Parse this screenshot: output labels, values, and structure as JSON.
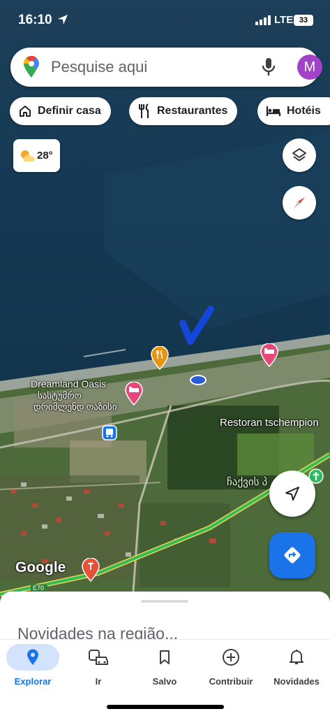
{
  "status_bar": {
    "time": "16:10",
    "network": "LTE",
    "battery": "33"
  },
  "search": {
    "placeholder": "Pesquise aqui",
    "avatar_letter": "M"
  },
  "chips": [
    {
      "label": "Definir casa",
      "icon": "home-icon"
    },
    {
      "label": "Restaurantes",
      "icon": "restaurant-icon"
    },
    {
      "label": "Hotéis",
      "icon": "hotel-icon"
    }
  ],
  "weather": {
    "temperature": "28°",
    "icon": "partly-cloudy-icon"
  },
  "map": {
    "labels": {
      "dreamland_latin": "Dreamland Oasis",
      "dreamland_georgian_1": "სასტუმრო",
      "dreamland_georgian_2": "დრიმლენდ ოაზისი",
      "restaurant": "Restoran tschempion",
      "georgian_place": "ჩაქვის პ",
      "google": "Google",
      "road": "E70"
    }
  },
  "bottom_sheet": {
    "title": "Novidades na região..."
  },
  "tabs": [
    {
      "label": "Explorar",
      "icon": "explore-pin-icon",
      "active": true
    },
    {
      "label": "Ir",
      "icon": "commute-icon",
      "active": false
    },
    {
      "label": "Salvo",
      "icon": "bookmark-icon",
      "active": false
    },
    {
      "label": "Contribuir",
      "icon": "add-circle-icon",
      "active": false
    },
    {
      "label": "Novidades",
      "icon": "bell-icon",
      "active": false
    }
  ],
  "colors": {
    "accent": "#1a73e8",
    "avatar": "#a142c8",
    "hotel_pin": "#e8477a",
    "food_pin": "#e8940e"
  }
}
